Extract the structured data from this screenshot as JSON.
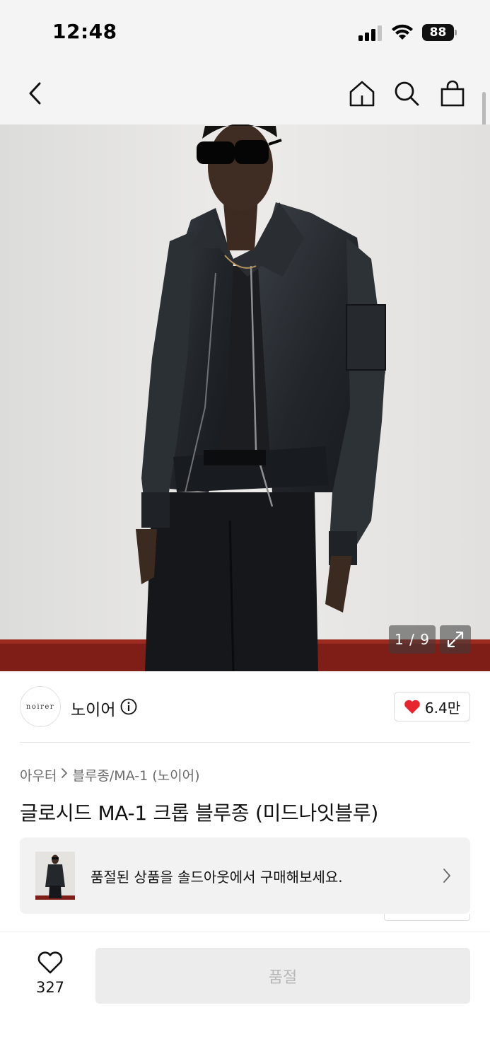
{
  "status_bar": {
    "time": "12:48",
    "battery": "88"
  },
  "nav": {
    "icons": [
      "back-chevron-icon",
      "home-icon",
      "search-icon",
      "shopping-bag-icon"
    ]
  },
  "gallery": {
    "counter": "1 / 9"
  },
  "brand": {
    "logo_text": "noirer",
    "name": "노이어",
    "like_count": "6.4만"
  },
  "breadcrumb": {
    "category": "아우터",
    "subcategory": "블루종/MA-1 (노이어)"
  },
  "product": {
    "title": "글로시드 MA-1 크롭 블루종 (미드나잇블루)"
  },
  "soldout_banner": {
    "text": "품절된 상품을 솔드아웃에서 구매해보세요."
  },
  "bottom_bar": {
    "wish_count": "327",
    "soldout_label": "품절"
  },
  "colors": {
    "heart": "#e8242f",
    "disabled_bg": "#ececec",
    "disabled_text": "#b7b7b7"
  }
}
